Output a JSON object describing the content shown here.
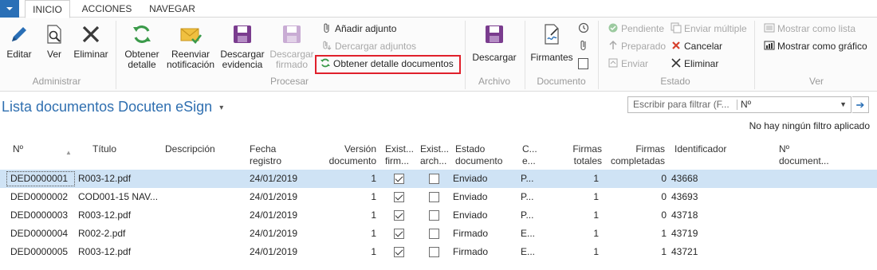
{
  "tabs": [
    "INICIO",
    "ACCIONES",
    "NAVEGAR"
  ],
  "ribbon": {
    "administrar": {
      "label": "Administrar",
      "editar": "Editar",
      "ver": "Ver",
      "eliminar": "Eliminar"
    },
    "procesar": {
      "label": "Procesar",
      "obtener_detalle": [
        "Obtener",
        "detalle"
      ],
      "reenviar": [
        "Reenviar",
        "notificación"
      ],
      "descargar_evidencia": [
        "Descargar",
        "evidencia"
      ],
      "descargar_firmado": [
        "Descargar",
        "firmado"
      ],
      "anadir_adjunto": "Añadir adjunto",
      "descargar_adjuntos": "Dercargar adjuntos",
      "obtener_detalle_documentos": "Obtener detalle documentos"
    },
    "archivo": {
      "label": "Archivo",
      "descargar": "Descargar"
    },
    "documento": {
      "label": "Documento",
      "firmantes": "Firmantes"
    },
    "estado": {
      "label": "Estado",
      "pendiente": "Pendiente",
      "preparado": "Preparado",
      "enviar": "Enviar",
      "enviar_multiple": "Enviar múltiple",
      "cancelar": "Cancelar",
      "eliminar": "Eliminar"
    },
    "ver": {
      "label": "Ver",
      "mostrar_lista": "Mostrar como lista",
      "mostrar_grafico": "Mostrar como gráfico"
    }
  },
  "page": {
    "title": "Lista documentos Docuten eSign",
    "filter_placeholder": "Escribir para filtrar (F...",
    "filter_field": "Nº",
    "no_filter": "No hay ningún filtro aplicado"
  },
  "columns": {
    "no": "Nº",
    "titulo": "Título",
    "descripcion": "Descripción",
    "fecha": [
      "Fecha",
      "registro"
    ],
    "version": [
      "Versión",
      "documento"
    ],
    "exist_firm": [
      "Exist...",
      "firm..."
    ],
    "exist_arch": [
      "Exist...",
      "arch..."
    ],
    "estado": [
      "Estado",
      "documento"
    ],
    "c": [
      "C...",
      "e..."
    ],
    "firmas_totales": [
      "Firmas",
      "totales"
    ],
    "firmas_completadas": [
      "Firmas",
      "completadas"
    ],
    "identificador": "Identificador",
    "no_documento": [
      "Nº",
      "document..."
    ]
  },
  "rows": [
    {
      "no": "DED0000001",
      "titulo": "R003-12.pdf",
      "descripcion": "",
      "fecha": "24/01/2019",
      "version": "1",
      "exist_firm": true,
      "exist_arch": false,
      "estado": "Enviado",
      "c": "P...",
      "firmas_totales": "1",
      "firmas_completadas": "0",
      "identificador": "43668",
      "no_documento": ""
    },
    {
      "no": "DED0000002",
      "titulo": "COD001-15 NAV...",
      "descripcion": "",
      "fecha": "24/01/2019",
      "version": "1",
      "exist_firm": true,
      "exist_arch": false,
      "estado": "Enviado",
      "c": "P...",
      "firmas_totales": "1",
      "firmas_completadas": "0",
      "identificador": "43693",
      "no_documento": ""
    },
    {
      "no": "DED0000003",
      "titulo": "R003-12.pdf",
      "descripcion": "",
      "fecha": "24/01/2019",
      "version": "1",
      "exist_firm": true,
      "exist_arch": false,
      "estado": "Enviado",
      "c": "P...",
      "firmas_totales": "1",
      "firmas_completadas": "0",
      "identificador": "43718",
      "no_documento": ""
    },
    {
      "no": "DED0000004",
      "titulo": "R002-2.pdf",
      "descripcion": "",
      "fecha": "24/01/2019",
      "version": "1",
      "exist_firm": true,
      "exist_arch": false,
      "estado": "Firmado",
      "c": "E...",
      "firmas_totales": "1",
      "firmas_completadas": "1",
      "identificador": "43719",
      "no_documento": ""
    },
    {
      "no": "DED0000005",
      "titulo": "R003-12.pdf",
      "descripcion": "",
      "fecha": "24/01/2019",
      "version": "1",
      "exist_firm": true,
      "exist_arch": false,
      "estado": "Firmado",
      "c": "E...",
      "firmas_totales": "1",
      "firmas_completadas": "1",
      "identificador": "43721",
      "no_documento": ""
    }
  ],
  "colors": {
    "accent": "#2a6fb6",
    "title": "#2f6fb0",
    "selected_row": "#cfe3f5",
    "highlight": "#e0202b",
    "disabled": "#a8a8a8"
  }
}
